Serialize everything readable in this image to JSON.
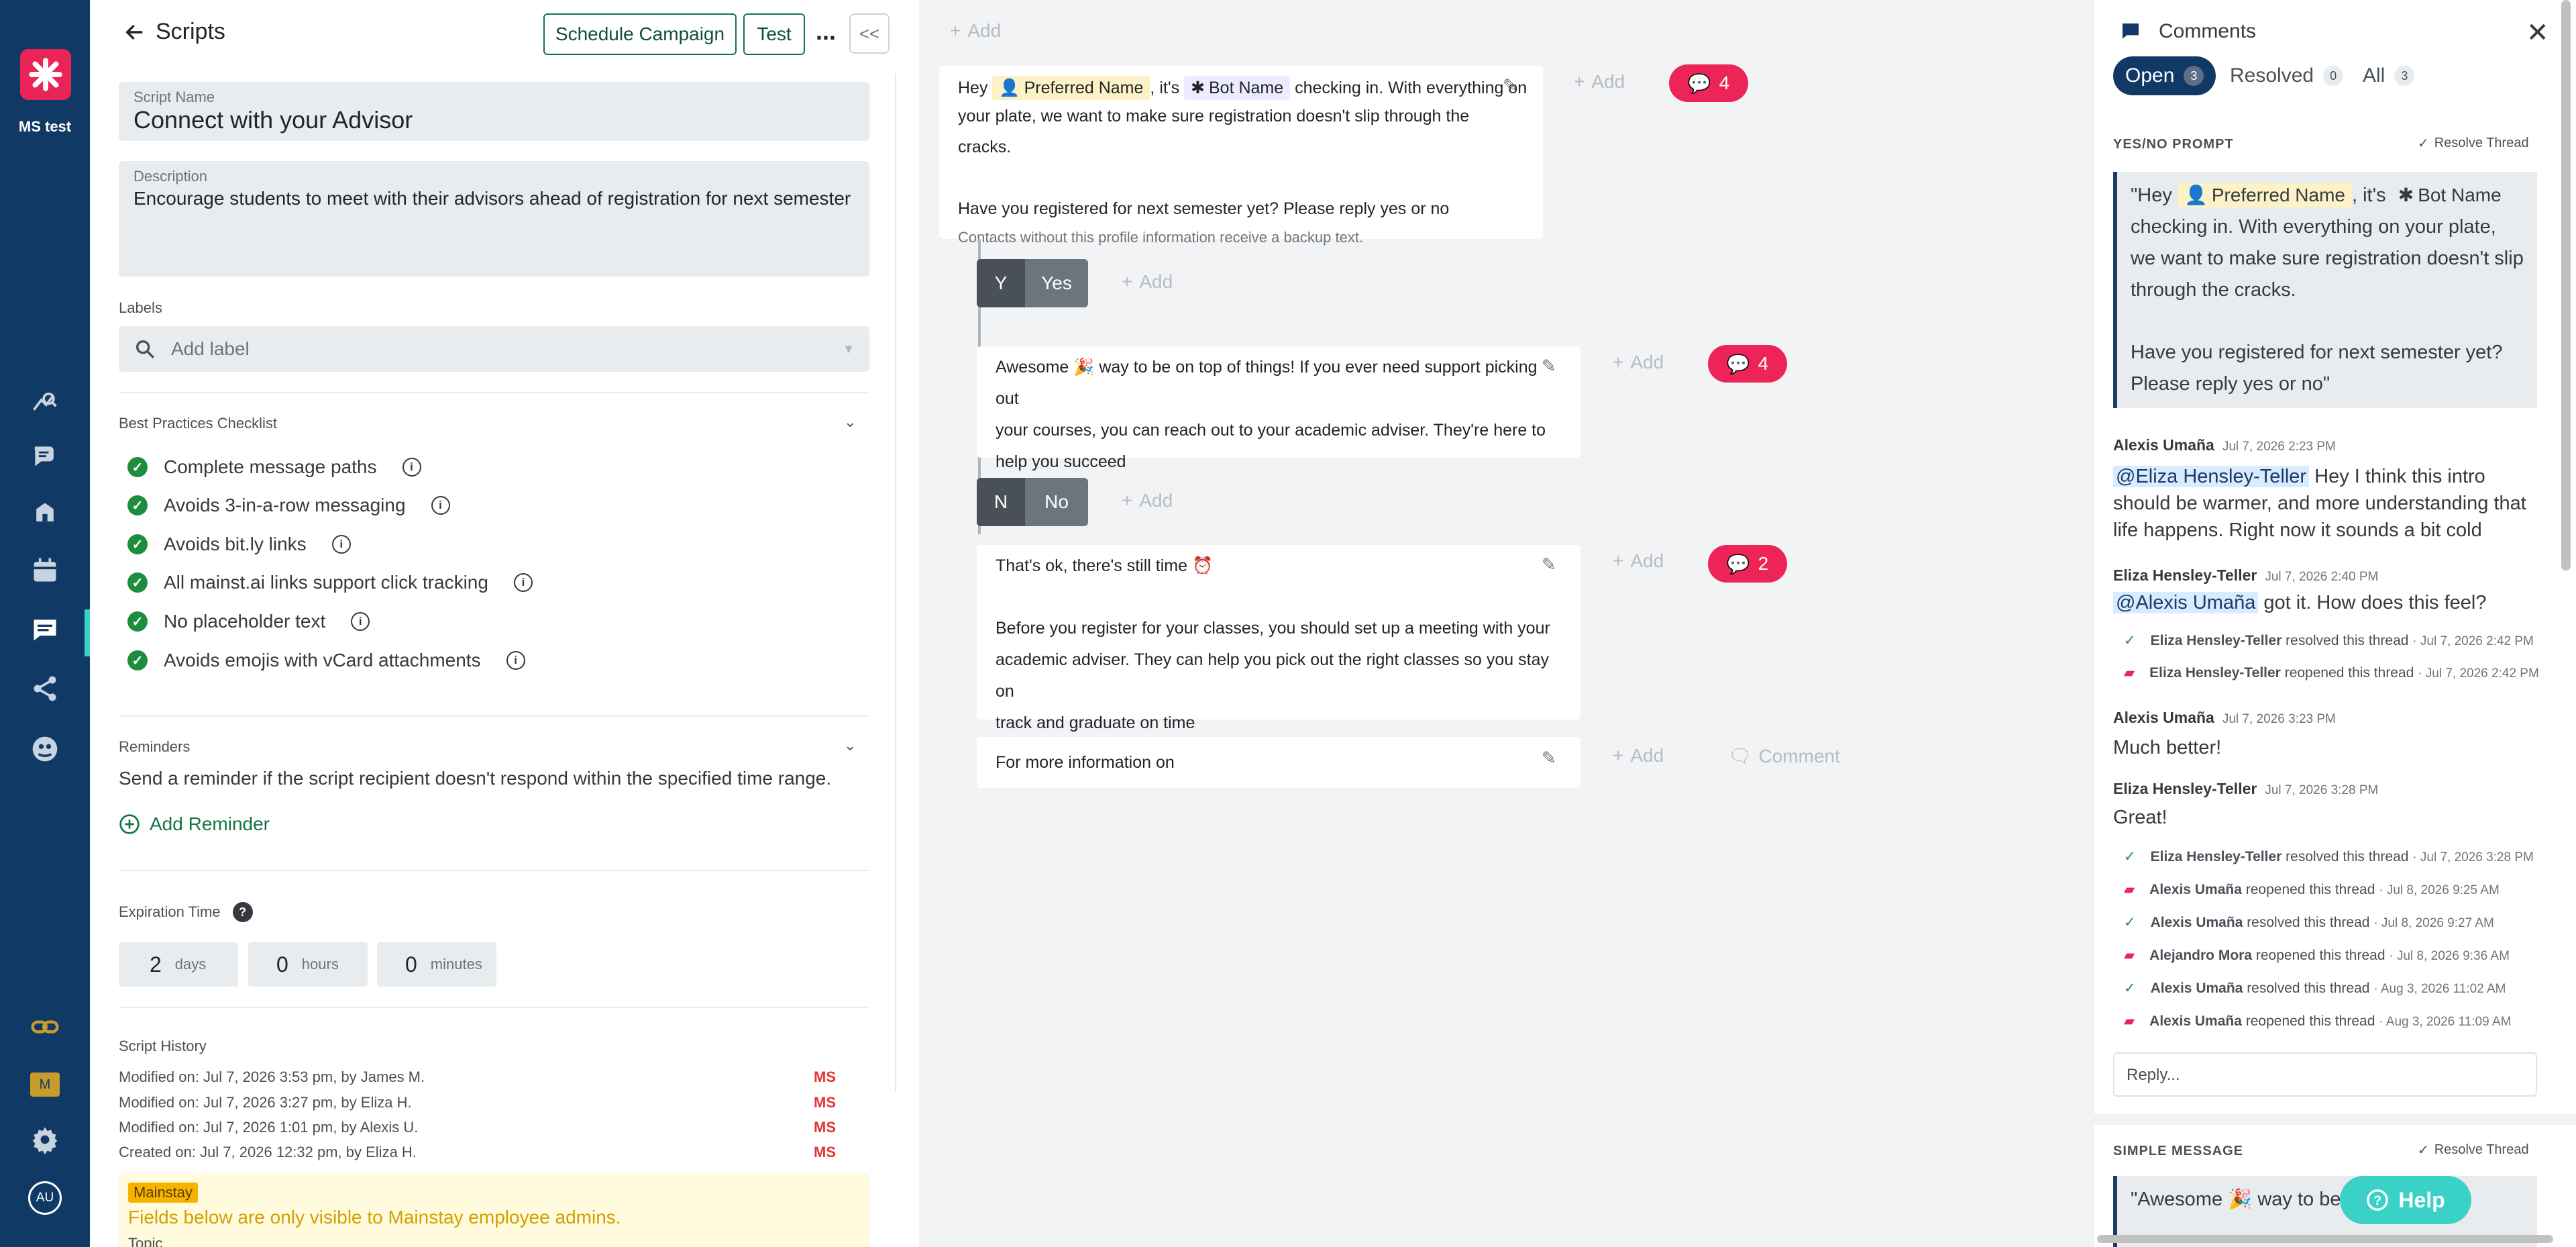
{
  "rail": {
    "org_name": "MS test",
    "badge_letter": "M",
    "avatar_initials": "AU",
    "accent": "#eb2458",
    "bg": "#103965"
  },
  "header": {
    "back_title": "Scripts",
    "schedule_label": "Schedule Campaign",
    "test_label": "Test",
    "more_label": "...",
    "collapse_label": "<<"
  },
  "script_name": {
    "label": "Script Name",
    "value": "Connect with your Advisor"
  },
  "description": {
    "label": "Description",
    "value": "Encourage students to meet with their advisors ahead of registration for next semester"
  },
  "labels": {
    "heading": "Labels",
    "placeholder": "Add label"
  },
  "checklist": {
    "heading": "Best Practices Checklist",
    "items": [
      "Complete message paths",
      "Avoids 3-in-a-row messaging",
      "Avoids bit.ly links",
      "All mainst.ai links support click tracking",
      "No placeholder text",
      "Avoids emojis with vCard attachments"
    ]
  },
  "reminders": {
    "heading": "Reminders",
    "text": "Send a reminder if the script recipient doesn't respond within the specified time range.",
    "add_label": "Add Reminder"
  },
  "expiration": {
    "heading": "Expiration Time",
    "days": "2",
    "days_unit": "days",
    "hours": "0",
    "hours_unit": "hours",
    "minutes": "0",
    "minutes_unit": "minutes"
  },
  "history": {
    "heading": "Script History",
    "rows": [
      {
        "text": "Modified on: Jul 7, 2026 3:53 pm, by James M.",
        "tag": "MS"
      },
      {
        "text": "Modified on: Jul 7, 2026 3:27 pm, by Eliza H.",
        "tag": "MS"
      },
      {
        "text": "Modified on: Jul 7, 2026 1:01 pm, by Alexis U.",
        "tag": "MS"
      },
      {
        "text": "Created on: Jul 7, 2026 12:32 pm, by Eliza H.",
        "tag": "MS"
      }
    ]
  },
  "mainstay_notice": {
    "badge": "Mainstay",
    "text": "Fields below are only visible to Mainstay employee admins.",
    "next_label": "Topic"
  },
  "canvas": {
    "add_label": "Add",
    "comment_label": "Comment",
    "intro": {
      "hey": "Hey",
      "preferred_name": "Preferred Name",
      "its": ", it's",
      "bot_name": "Bot Name",
      "line1_rest": "checking in. With everything on",
      "line2": "your plate, we want to make sure registration doesn't slip through the cracks.",
      "line3": "Have you registered for next semester yet? Please reply yes or no",
      "backup": "Contacts without this profile information receive a backup text.",
      "count": "4"
    },
    "yes_branch": {
      "key": "Y",
      "label": "Yes"
    },
    "yes_message": {
      "text1": "Awesome 🎉 way to be on top of things! If you ever need support picking out",
      "text2": "your courses, you can reach out to your academic adviser. They're here to",
      "text3": "help you succeed",
      "count": "4"
    },
    "no_branch": {
      "key": "N",
      "label": "No"
    },
    "no_message": {
      "text1": "That's ok, there's still time ⏰",
      "text2": "Before you register for your classes, you should set up a meeting with your",
      "text3": "academic adviser. They can help you pick out the right classes so you stay on",
      "text4": "track and graduate on time",
      "count": "2"
    },
    "info_message": {
      "text": "For more information on"
    }
  },
  "comments": {
    "title": "Comments",
    "tabs": [
      {
        "label": "Open",
        "count": "3"
      },
      {
        "label": "Resolved",
        "count": "0"
      },
      {
        "label": "All",
        "count": "3"
      }
    ],
    "thread1": {
      "type": "YES/NO PROMPT",
      "resolve_label": "Resolve Thread",
      "quote_hey": "\"Hey",
      "quote_pn": "Preferred Name",
      "quote_its": ", it's",
      "quote_bn": "Bot Name",
      "quote_l2": "checking in. With everything on your plate, we want to make sure registration doesn't slip through the cracks.",
      "quote_l3": "Have you registered for next semester yet? Please reply yes or no\""
    },
    "c1": {
      "author": "Alexis Umaña",
      "time": "Jul 7, 2026 2:23 PM",
      "mention": "@Eliza Hensley-Teller",
      "text": "Hey I think this intro should be warmer, and more understanding that life happens. Right now it sounds a bit cold"
    },
    "c2": {
      "author": "Eliza Hensley-Teller",
      "time": "Jul 7, 2026 2:40 PM",
      "mention": "@Alexis Umaña",
      "text": "got it. How does this feel?"
    },
    "e1": {
      "who": "Eliza Hensley-Teller",
      "action": "resolved this thread",
      "date": "· Jul 7, 2026 2:42 PM"
    },
    "e2": {
      "who": "Eliza Hensley-Teller",
      "action": "reopened this thread",
      "date": "· Jul 7, 2026 2:42 PM"
    },
    "c3": {
      "author": "Alexis Umaña",
      "time": "Jul 7, 2026 3:23 PM",
      "text": "Much better!"
    },
    "c4": {
      "author": "Eliza Hensley-Teller",
      "time": "Jul 7, 2026 3:28 PM",
      "text": "Great!"
    },
    "e3": {
      "who": "Eliza Hensley-Teller",
      "action": "resolved this thread",
      "date": "· Jul 7, 2026 3:28 PM"
    },
    "e4": {
      "who": "Alexis Umaña",
      "action": "reopened this thread",
      "date": "· Jul 8, 2026 9:25 AM"
    },
    "e5": {
      "who": "Alexis Umaña",
      "action": "resolved this thread",
      "date": "· Jul 8, 2026 9:27 AM"
    },
    "e6": {
      "who": "Alejandro Mora",
      "action": "reopened this thread",
      "date": "· Jul 8, 2026 9:36 AM"
    },
    "e7": {
      "who": "Alexis Umaña",
      "action": "resolved this thread",
      "date": "· Aug 3, 2026 11:02 AM"
    },
    "e8": {
      "who": "Alexis Umaña",
      "action": "reopened this thread",
      "date": "· Aug 3, 2026 11:09 AM"
    },
    "reply_placeholder": "Reply...",
    "thread2": {
      "type": "SIMPLE MESSAGE",
      "resolve_label": "Resolve Thread",
      "quote": "\"Awesome 🎉 way to be on top of thi"
    }
  },
  "help": {
    "label": "Help"
  }
}
